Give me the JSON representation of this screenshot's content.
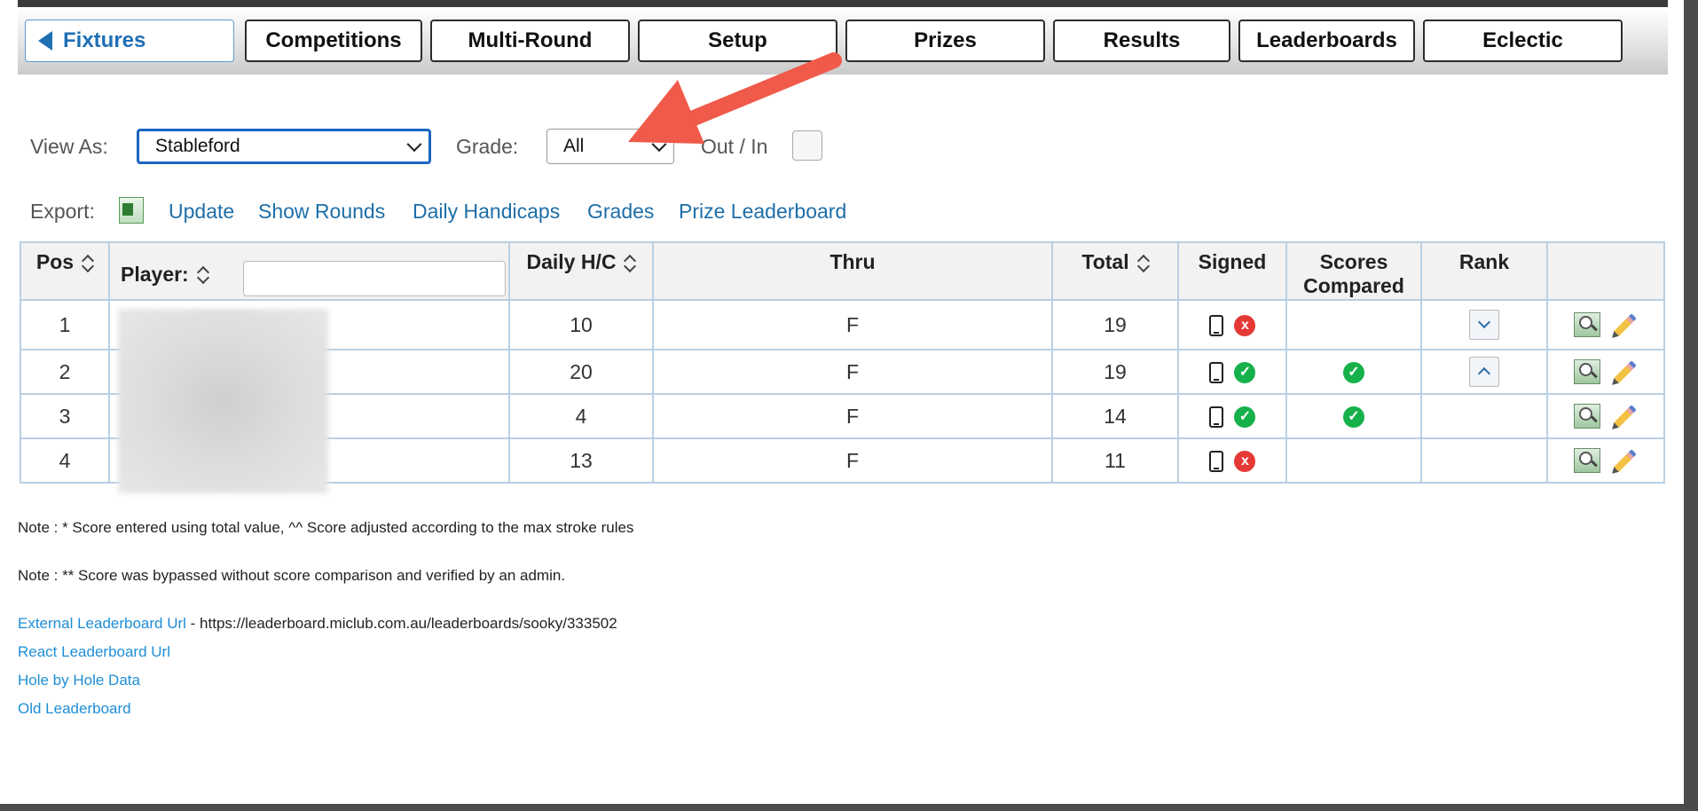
{
  "tabs": {
    "back": "Fixtures",
    "competitions": "Competitions",
    "multi_round": "Multi-Round",
    "setup": "Setup",
    "prizes": "Prizes",
    "results": "Results",
    "leaderboards": "Leaderboards",
    "eclectic": "Eclectic"
  },
  "filters": {
    "view_as_label": "View As:",
    "view_as_value": "Stableford",
    "grade_label": "Grade:",
    "grade_value": "All",
    "out_in_label": "Out / In"
  },
  "actions": {
    "export_label": "Export:",
    "update": "Update",
    "show_rounds": "Show Rounds",
    "daily_handicaps": "Daily Handicaps",
    "grades": "Grades",
    "prize_leaderboard": "Prize Leaderboard"
  },
  "table": {
    "headers": {
      "pos": "Pos",
      "player": "Player:",
      "daily_hc": "Daily H/C",
      "thru": "Thru",
      "total": "Total",
      "signed": "Signed",
      "scores_compared_1": "Scores",
      "scores_compared_2": "Compared",
      "rank": "Rank"
    },
    "rows": [
      {
        "pos": "1",
        "hc": "10",
        "thru": "F",
        "total": "19",
        "signed": "x",
        "compared": ""
      },
      {
        "pos": "2",
        "hc": "20",
        "thru": "F",
        "total": "19",
        "signed": "✓",
        "compared": "✓"
      },
      {
        "pos": "3",
        "hc": "4",
        "thru": "F",
        "total": "14",
        "signed": "✓",
        "compared": "✓"
      },
      {
        "pos": "4",
        "hc": "13",
        "thru": "F",
        "total": "11",
        "signed": "x",
        "compared": ""
      }
    ]
  },
  "notes": {
    "note1": "Note : * Score entered using total value, ^^ Score adjusted according to the max stroke rules",
    "note2": "Note : ** Score was bypassed without score comparison and verified by an admin."
  },
  "links": {
    "external_label": "External Leaderboard Url",
    "external_url": " - https://leaderboard.miclub.com.au/leaderboards/sooky/333502",
    "react": "React Leaderboard Url",
    "hole_by_hole": "Hole by Hole Data",
    "old": "Old Leaderboard"
  },
  "colors": {
    "link": "#1e6ea8",
    "annotation_arrow": "#f05a4a",
    "green_check": "#17b14b",
    "red_x": "#e53935"
  }
}
